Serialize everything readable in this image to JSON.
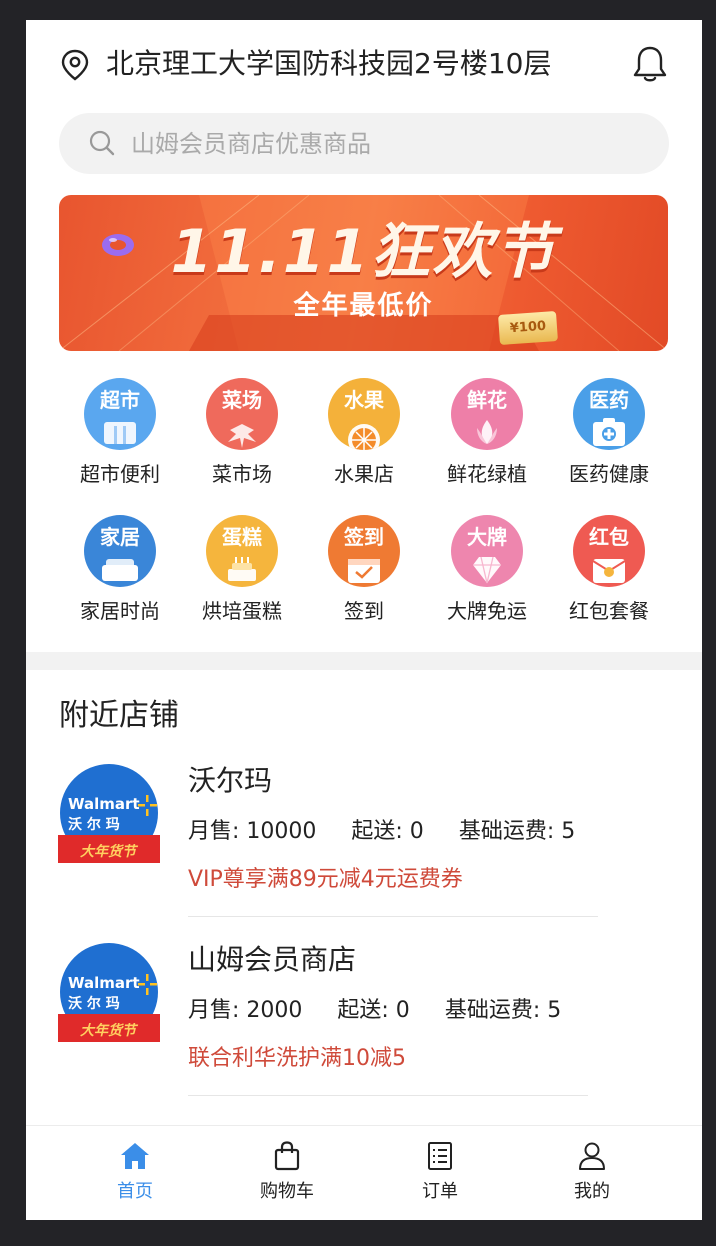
{
  "header": {
    "address": "北京理工大学国防科技园2号楼10层",
    "location_icon": "location-pin-icon",
    "bell_icon": "bell-icon"
  },
  "search": {
    "placeholder": "山姆会员商店优惠商品",
    "icon": "search-icon"
  },
  "banner": {
    "title": "11.11狂欢节",
    "subtitle": "全年最低价",
    "tag": "¥100"
  },
  "categories": [
    {
      "label": "超市便利",
      "badge": "超市",
      "icon": "supermarket-icon",
      "color": "#5aa7ef"
    },
    {
      "label": "菜市场",
      "badge": "菜场",
      "icon": "vegetable-icon",
      "color": "#ef6a5c"
    },
    {
      "label": "水果店",
      "badge": "水果",
      "icon": "fruit-icon",
      "color": "#f4b13a"
    },
    {
      "label": "鲜花绿植",
      "badge": "鲜花",
      "icon": "flower-icon",
      "color": "#ee7fa8"
    },
    {
      "label": "医药健康",
      "badge": "医药",
      "icon": "medicine-icon",
      "color": "#4a9fe8"
    },
    {
      "label": "家居时尚",
      "badge": "家居",
      "icon": "furniture-icon",
      "color": "#3a86d8"
    },
    {
      "label": "烘培蛋糕",
      "badge": "蛋糕",
      "icon": "cake-icon",
      "color": "#f5b53d"
    },
    {
      "label": "签到",
      "badge": "签到",
      "icon": "calendar-check-icon",
      "color": "#ef7a33"
    },
    {
      "label": "大牌免运",
      "badge": "大牌",
      "icon": "diamond-icon",
      "color": "#ee86ae"
    },
    {
      "label": "红包套餐",
      "badge": "红包",
      "icon": "red-packet-icon",
      "color": "#ef5a52"
    }
  ],
  "nearby": {
    "title": "附近店铺",
    "stores": [
      {
        "name": "沃尔玛",
        "monthly_sales": "月售: 10000",
        "min_order": "起送: 0",
        "delivery_fee": "基础运费: 5",
        "promo": "VIP尊享满89元减4元运费券",
        "logo_text": "Walmart",
        "logo_cn": "沃 尔 玛",
        "logo_ribbon": "大年货节"
      },
      {
        "name": "山姆会员商店",
        "monthly_sales": "月售: 2000",
        "min_order": "起送: 0",
        "delivery_fee": "基础运费: 5",
        "promo": "联合利华洗护满10减5",
        "logo_text": "Walmart",
        "logo_cn": "沃 尔 玛",
        "logo_ribbon": "大年货节"
      }
    ]
  },
  "tabbar": {
    "tabs": [
      {
        "label": "首页",
        "icon": "home-icon",
        "active": true
      },
      {
        "label": "购物车",
        "icon": "shopping-bag-icon",
        "active": false
      },
      {
        "label": "订单",
        "icon": "order-list-icon",
        "active": false
      },
      {
        "label": "我的",
        "icon": "user-icon",
        "active": false
      }
    ]
  },
  "colors": {
    "accent": "#3b8ee8",
    "promo": "#cf4a3a",
    "walmart_blue": "#1f6fd1"
  }
}
